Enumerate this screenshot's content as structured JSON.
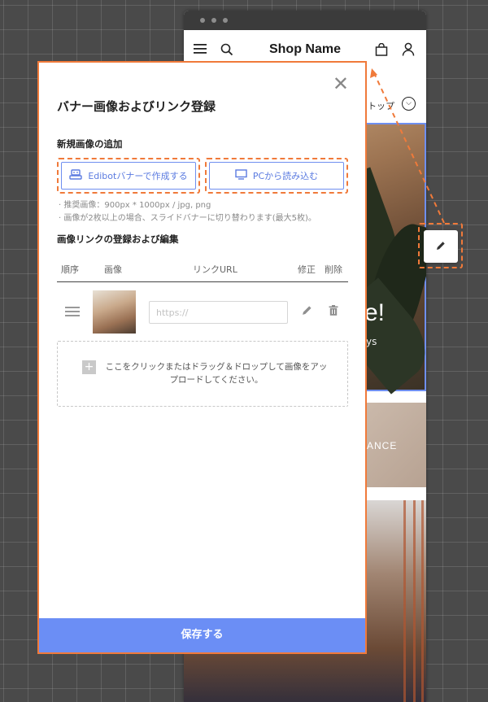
{
  "preview": {
    "shop_name": "Shop Name",
    "nav_label": "トップ",
    "banner_text": "e!",
    "banner_subtext": "ys",
    "banner2_text": "ANCE"
  },
  "modal": {
    "title": "バナー画像およびリンク登録",
    "new_image_section": "新規画像の追加",
    "edibot_button": "Edibotバナーで作成する",
    "pc_button": "PCから読み込む",
    "note_1": "· 推奨画像：900px * 1000px / jpg, png",
    "note_2": "· 画像が2枚以上の場合、スライドバナーに切り替わります(最大5枚)。",
    "link_section": "画像リンクの登録および編集",
    "columns": {
      "order": "順序",
      "image": "画像",
      "url": "リンクURL",
      "edit": "修正",
      "delete": "削除"
    },
    "rows": [
      {
        "url_placeholder": "https://"
      }
    ],
    "dropzone_text": "ここをクリックまたはドラッグ＆ドロップして画像をアップロードしてください。",
    "save_button": "保存する"
  },
  "colors": {
    "accent_orange": "#f07a3a",
    "primary_blue": "#6b8ef5"
  }
}
